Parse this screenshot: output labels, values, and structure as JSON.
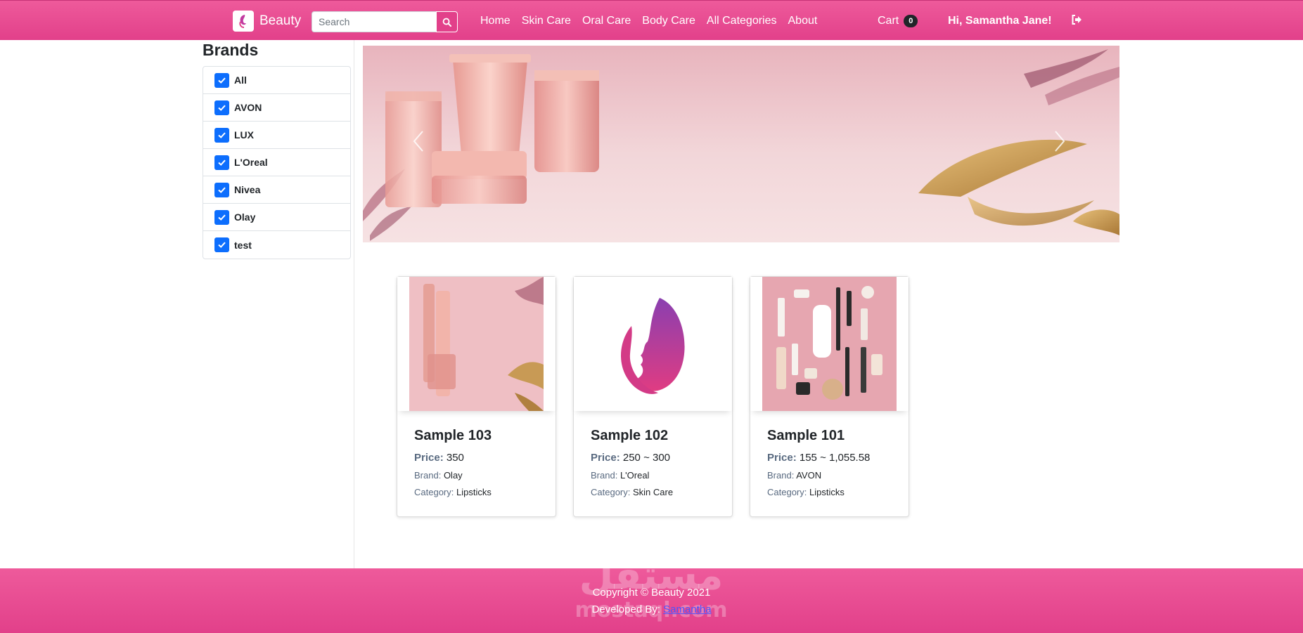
{
  "header": {
    "brand_name": "Beauty",
    "search_placeholder": "Search",
    "nav": [
      "Home",
      "Skin Care",
      "Oral Care",
      "Body Care",
      "All Categories",
      "About"
    ],
    "cart_label": "Cart",
    "cart_count": "0",
    "greeting": "Hi, Samantha Jane!"
  },
  "sidebar": {
    "title": "Brands",
    "brands": [
      {
        "label": "All",
        "checked": true
      },
      {
        "label": "AVON",
        "checked": true
      },
      {
        "label": "LUX",
        "checked": true
      },
      {
        "label": "L'Oreal",
        "checked": true
      },
      {
        "label": "Nivea",
        "checked": true
      },
      {
        "label": "Olay",
        "checked": true
      },
      {
        "label": "test",
        "checked": true
      }
    ]
  },
  "products": [
    {
      "title": "Sample 103",
      "price_label": "Price:",
      "price": "350",
      "brand_label": "Brand:",
      "brand": "Olay",
      "category_label": "Category:",
      "category": "Lipsticks"
    },
    {
      "title": "Sample 102",
      "price_label": "Price:",
      "price": "250 ~ 300",
      "brand_label": "Brand:",
      "brand": "L'Oreal",
      "category_label": "Category:",
      "category": "Skin Care"
    },
    {
      "title": "Sample 101",
      "price_label": "Price:",
      "price": "155 ~ 1,055.58",
      "brand_label": "Brand:",
      "brand": "AVON",
      "category_label": "Category:",
      "category": "Lipsticks"
    }
  ],
  "footer": {
    "copyright": "Copyright © Beauty 2021",
    "developed_by": "Developed By:",
    "developer_link": "Samantha"
  },
  "watermark": {
    "text": "مستقل",
    "subtext": "mostaql.com"
  },
  "colors": {
    "brand_pink": "#e2408a",
    "checkbox_blue": "#0d6efd"
  }
}
